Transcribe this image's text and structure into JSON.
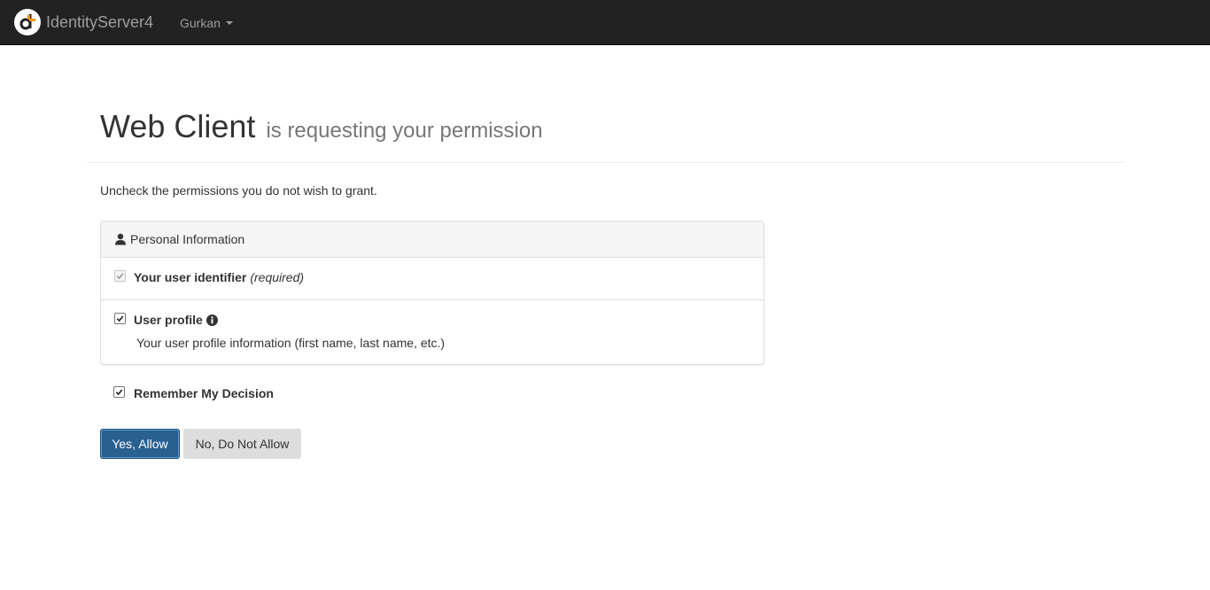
{
  "navbar": {
    "brand": "IdentityServer4",
    "user": "Gurkan"
  },
  "header": {
    "client_name": "Web Client",
    "subtitle": "is requesting your permission"
  },
  "intro": "Uncheck the permissions you do not wish to grant.",
  "panel": {
    "heading": "Personal Information",
    "scopes": [
      {
        "label": "Your user identifier",
        "required": "(required)",
        "checked": true,
        "disabled": true
      },
      {
        "label": "User profile",
        "description": "Your user profile information (first name, last name, etc.)",
        "checked": true,
        "disabled": false
      }
    ]
  },
  "remember": {
    "label": "Remember My Decision",
    "checked": true
  },
  "buttons": {
    "allow": "Yes, Allow",
    "deny": "No, Do Not Allow"
  },
  "colors": {
    "navbar_bg": "#222222",
    "primary": "#286090",
    "logo_orange": "#f7931e"
  }
}
